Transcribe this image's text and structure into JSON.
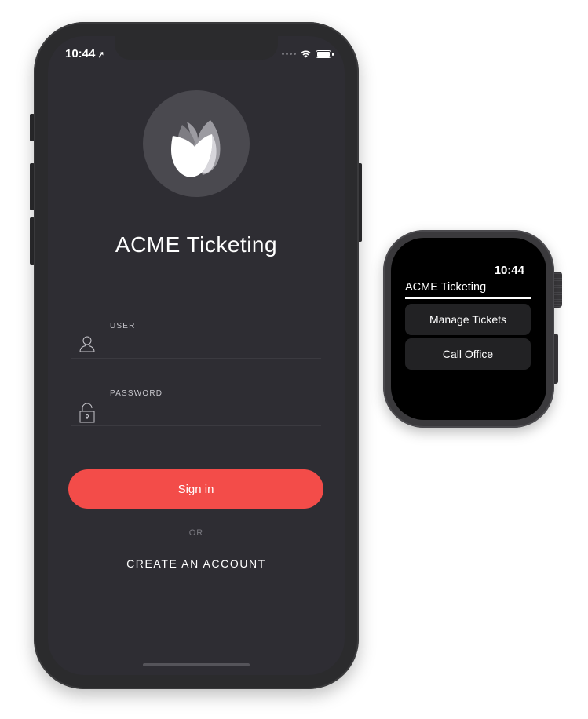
{
  "phone": {
    "status_bar": {
      "time": "10:44",
      "location_icon": "location-arrow-icon",
      "wifi_icon": "wifi-icon",
      "battery_icon": "battery-icon"
    },
    "logo_icon": "tulip-logo-icon",
    "app_title": "ACME Ticketing",
    "fields": {
      "user": {
        "label": "USER",
        "value": "",
        "icon": "user-icon"
      },
      "password": {
        "label": "PASSWORD",
        "value": "",
        "icon": "padlock-icon"
      }
    },
    "sign_in_label": "Sign in",
    "or_text": "OR",
    "create_account_label": "CREATE AN ACCOUNT"
  },
  "watch": {
    "time": "10:44",
    "title": "ACME Ticketing",
    "buttons": {
      "manage": "Manage Tickets",
      "call": "Call Office"
    }
  },
  "colors": {
    "screen_bg": "#2e2d33",
    "accent": "#f34c49",
    "watch_button_bg": "#222224"
  }
}
